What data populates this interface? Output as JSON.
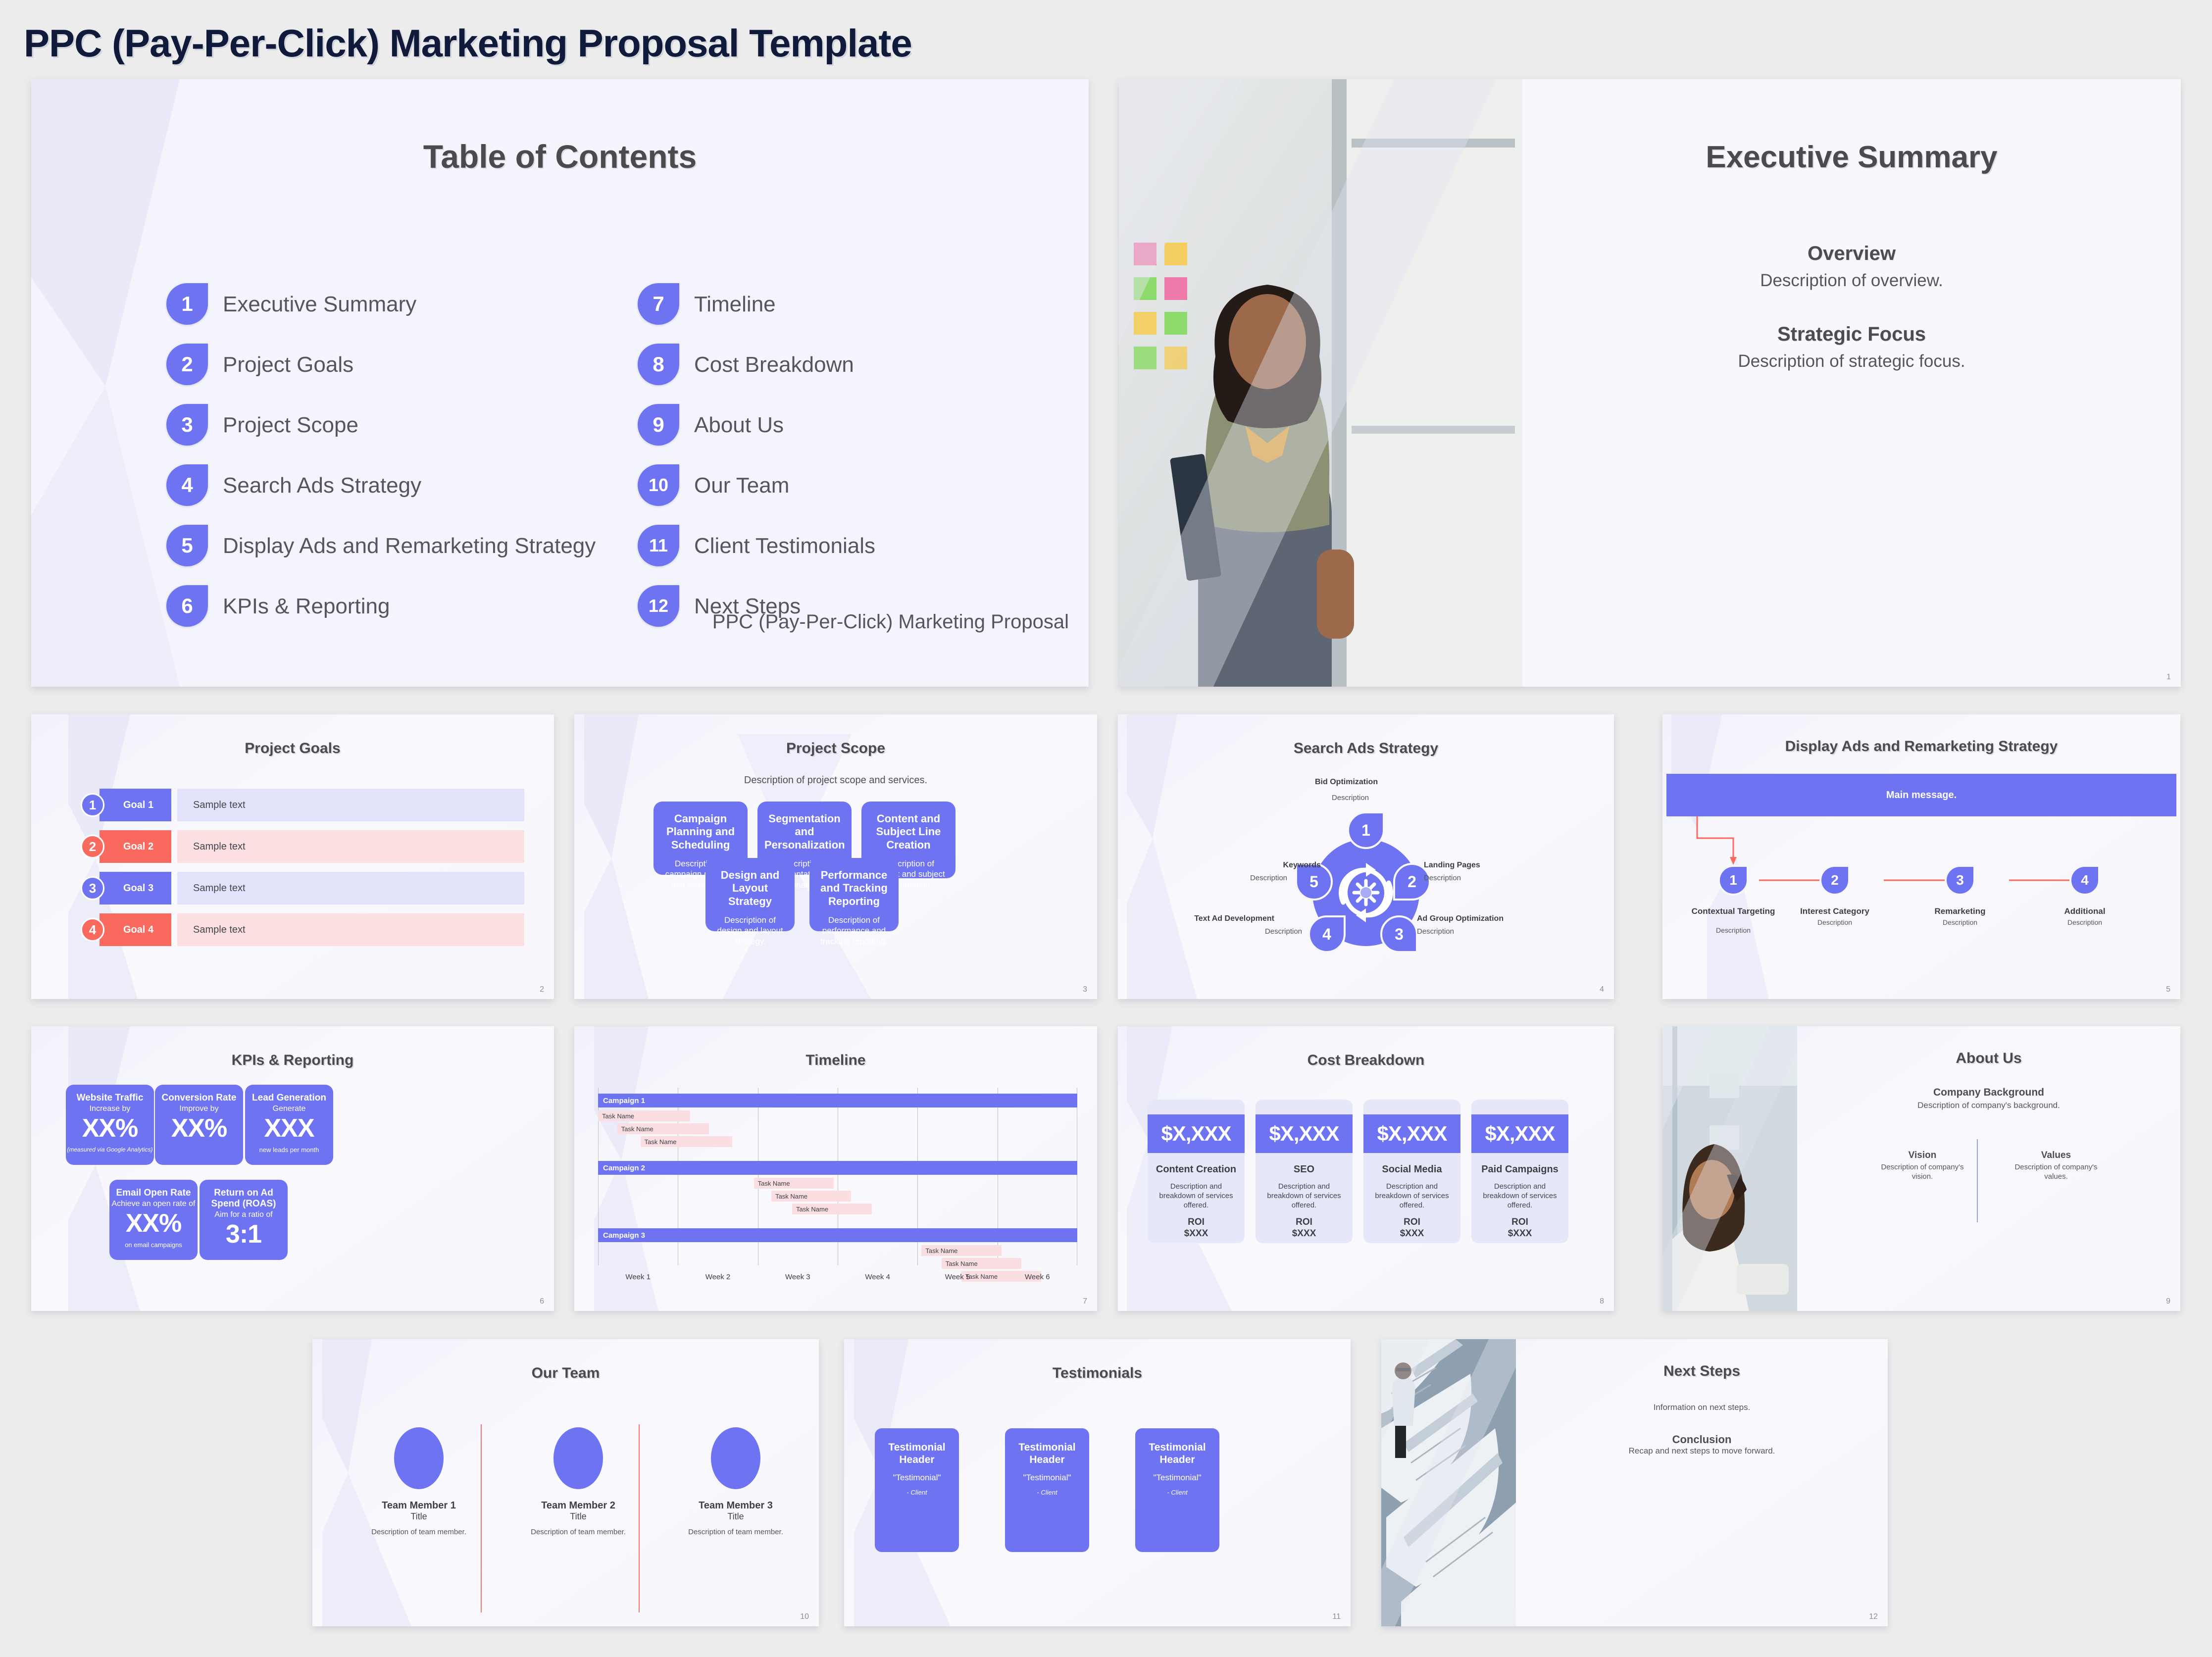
{
  "doc": {
    "title": "PPC (Pay-Per-Click) Marketing Proposal Template"
  },
  "colors": {
    "accent": "#6e74f1",
    "accent_light": "#e2e2fa",
    "red": "#f9695e",
    "red_light": "#fbdfe1",
    "pink_bar": "#fadee1",
    "title_navy": "#101a3a",
    "slide_title": "#4b4b4d"
  },
  "toc": {
    "title": "Table of Contents",
    "footer": "PPC (Pay-Per-Click) Marketing Proposal",
    "page": "",
    "left": [
      {
        "num": "1",
        "label": "Executive Summary"
      },
      {
        "num": "2",
        "label": "Project Goals"
      },
      {
        "num": "3",
        "label": "Project Scope"
      },
      {
        "num": "4",
        "label": "Search Ads Strategy"
      },
      {
        "num": "5",
        "label": "Display Ads and Remarketing Strategy"
      },
      {
        "num": "6",
        "label": "KPIs & Reporting"
      }
    ],
    "right": [
      {
        "num": "7",
        "label": "Timeline"
      },
      {
        "num": "8",
        "label": "Cost Breakdown"
      },
      {
        "num": "9",
        "label": "About Us"
      },
      {
        "num": "10",
        "label": "Our Team"
      },
      {
        "num": "11",
        "label": "Client Testimonials"
      },
      {
        "num": "12",
        "label": "Next Steps"
      }
    ]
  },
  "exec": {
    "title": "Executive Summary",
    "page": "1",
    "photo_alt": "smiling-woman-with-notebook-by-window",
    "sections": [
      {
        "heading": "Overview",
        "text": "Description of overview."
      },
      {
        "heading": "Strategic Focus",
        "text": "Description of strategic focus."
      }
    ]
  },
  "goals": {
    "title": "Project Goals",
    "page": "2",
    "rows": [
      {
        "num": "1",
        "tag": "Goal 1",
        "body": "Sample text",
        "tag_color": "#6e74f1",
        "body_color": "#e2e2fa"
      },
      {
        "num": "2",
        "tag": "Goal 2",
        "body": "Sample text",
        "tag_color": "#f9695e",
        "body_color": "#fbdfe1"
      },
      {
        "num": "3",
        "tag": "Goal 3",
        "body": "Sample text",
        "tag_color": "#6e74f1",
        "body_color": "#e2e2fa"
      },
      {
        "num": "4",
        "tag": "Goal 4",
        "body": "Sample text",
        "tag_color": "#f9695e",
        "body_color": "#fbdfe1"
      }
    ]
  },
  "scope": {
    "title": "Project Scope",
    "subtitle": "Description of project scope and services.",
    "page": "3",
    "cards": [
      {
        "heading": "Campaign Planning and Scheduling",
        "text": "Description of campaign planning and scheduling."
      },
      {
        "heading": "Segmentation and Personalization",
        "text": "Description of segmentation and personalization."
      },
      {
        "heading": "Content and Subject Line Creation",
        "text": "Description of content and subject line creation."
      },
      {
        "heading": "Design and Layout Strategy",
        "text": "Description of design and layout strategy."
      },
      {
        "heading": "Performance and Tracking Reporting",
        "text": "Description of performance and tracking reporting."
      }
    ]
  },
  "search": {
    "title": "Search Ads Strategy",
    "page": "4",
    "center_icon": "gear-refresh-cycle-icon",
    "nodes": [
      {
        "num": "1",
        "label": "Bid Optimization",
        "desc": "Description"
      },
      {
        "num": "2",
        "label": "Landing Pages",
        "desc": "Description"
      },
      {
        "num": "3",
        "label": "Ad Group Optimization",
        "desc": "Description"
      },
      {
        "num": "4",
        "label": "Text Ad Development",
        "desc": "Description"
      },
      {
        "num": "5",
        "label": "Keywords",
        "desc": "Description"
      }
    ]
  },
  "display": {
    "title": "Display Ads and Remarketing Strategy",
    "main_message": "Main message.",
    "page": "5",
    "steps": [
      {
        "num": "1",
        "label": "Contextual Targeting",
        "desc": "Description"
      },
      {
        "num": "2",
        "label": "Interest Category",
        "desc": "Description"
      },
      {
        "num": "3",
        "label": "Remarketing",
        "desc": "Description"
      },
      {
        "num": "4",
        "label": "Additional",
        "desc": "Description"
      }
    ]
  },
  "kpi": {
    "title": "KPIs & Reporting",
    "page": "6",
    "cards": [
      {
        "heading": "Website Traffic",
        "sub": "Increase by",
        "value": "XX%",
        "foot": "(measured via Google Analytics)",
        "italic": true
      },
      {
        "heading": "Conversion Rate",
        "sub": "Improve by",
        "value": "XX%",
        "foot": "",
        "italic": false
      },
      {
        "heading": "Lead Generation",
        "sub": "Generate",
        "value": "XXX",
        "foot": "new leads per month",
        "italic": false
      },
      {
        "heading": "Email Open Rate",
        "sub": "Achieve an open rate of",
        "value": "XX%",
        "foot": "on email campaigns",
        "italic": false
      },
      {
        "heading": "Return on Ad Spend (ROAS)",
        "sub": "Aim for a ratio of",
        "value": "3:1",
        "foot": "",
        "italic": false
      }
    ]
  },
  "timeline": {
    "title": "Timeline",
    "page": "7",
    "weeks": [
      "Week 1",
      "Week 2",
      "Week 3",
      "Week 4",
      "Week 5",
      "Week 6"
    ],
    "campaigns": [
      {
        "name": "Campaign 1",
        "tasks": [
          {
            "label": "Task Name",
            "start": 0.0,
            "span": 1.15
          },
          {
            "label": "Task Name",
            "start": 0.24,
            "span": 1.15
          },
          {
            "label": "Task Name",
            "start": 0.53,
            "span": 1.15
          }
        ]
      },
      {
        "name": "Campaign 2",
        "tasks": [
          {
            "label": "Task Name",
            "start": 1.95,
            "span": 1.0
          },
          {
            "label": "Task Name",
            "start": 2.17,
            "span": 1.0
          },
          {
            "label": "Task Name",
            "start": 2.43,
            "span": 1.0
          }
        ]
      },
      {
        "name": "Campaign 3",
        "tasks": [
          {
            "label": "Task Name",
            "start": 4.05,
            "span": 1.0
          },
          {
            "label": "Task Name",
            "start": 4.3,
            "span": 1.0
          },
          {
            "label": "Task Name",
            "start": 4.55,
            "span": 1.0
          }
        ]
      }
    ]
  },
  "cost": {
    "title": "Cost Breakdown",
    "page": "8",
    "cards": [
      {
        "amount": "$X,XXX",
        "name": "Content Creation",
        "desc": "Description and breakdown of services offered.",
        "roi_label": "ROI",
        "roi_value": "$XXX"
      },
      {
        "amount": "$X,XXX",
        "name": "SEO",
        "desc": "Description and breakdown of services offered.",
        "roi_label": "ROI",
        "roi_value": "$XXX"
      },
      {
        "amount": "$X,XXX",
        "name": "Social Media",
        "desc": "Description and breakdown of services offered.",
        "roi_label": "ROI",
        "roi_value": "$XXX"
      },
      {
        "amount": "$X,XXX",
        "name": "Paid Campaigns",
        "desc": "Description and breakdown of services offered.",
        "roi_label": "ROI",
        "roi_value": "$XXX"
      }
    ]
  },
  "about": {
    "title": "About Us",
    "page": "9",
    "photo_alt": "woman-looking-up-in-office",
    "background_heading": "Company Background",
    "background_text": "Description of company's background.",
    "columns": [
      {
        "heading": "Vision",
        "text": "Description of company's vision."
      },
      {
        "heading": "Values",
        "text": "Description of company's values."
      }
    ]
  },
  "team": {
    "title": "Our Team",
    "page": "10",
    "members": [
      {
        "name": "Team Member 1",
        "role": "Title",
        "desc": "Description of team member."
      },
      {
        "name": "Team Member 2",
        "role": "Title",
        "desc": "Description of team member."
      },
      {
        "name": "Team Member 3",
        "role": "Title",
        "desc": "Description of team member."
      }
    ]
  },
  "testimonials": {
    "title": "Testimonials",
    "page": "11",
    "cards": [
      {
        "heading": "Testimonial Header",
        "quote": "\"Testimonial\"",
        "client": "- Client"
      },
      {
        "heading": "Testimonial Header",
        "quote": "\"Testimonial\"",
        "client": "- Client"
      },
      {
        "heading": "Testimonial Header",
        "quote": "\"Testimonial\"",
        "client": "- Client"
      }
    ]
  },
  "next": {
    "title": "Next Steps",
    "page": "12",
    "photo_alt": "man-on-spiral-staircase",
    "info": "Information on next steps.",
    "conclusion_heading": "Conclusion",
    "conclusion_text": "Recap and next steps to move forward."
  }
}
